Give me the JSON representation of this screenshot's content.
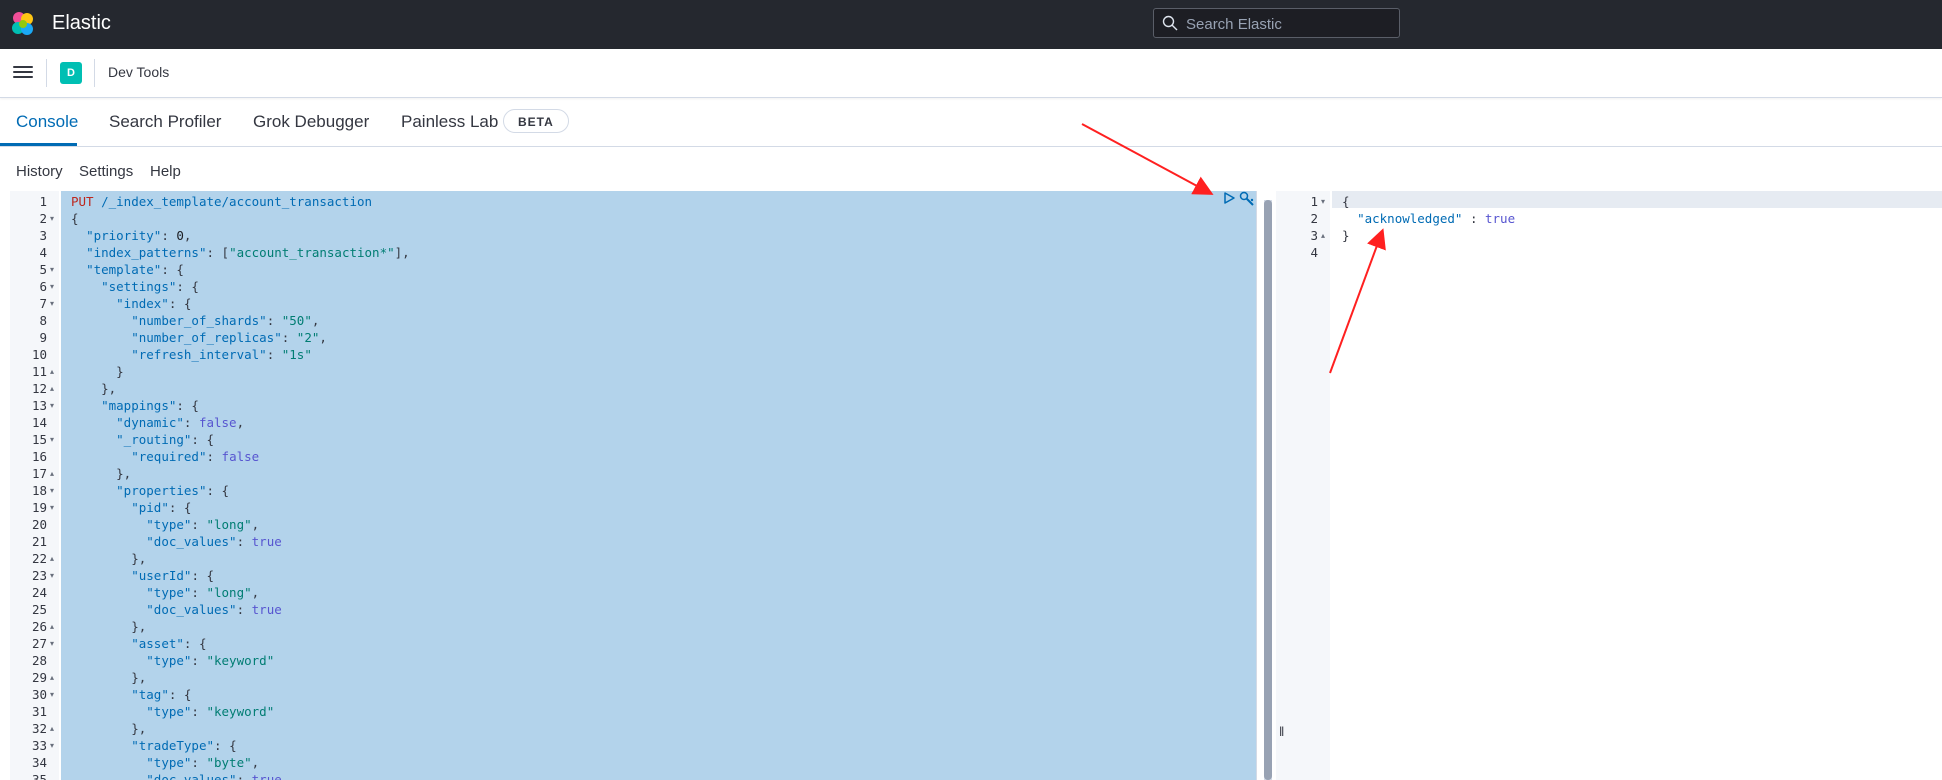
{
  "header": {
    "brand": "Elastic",
    "search_placeholder": "Search Elastic"
  },
  "breadcrumb": {
    "space_initial": "D",
    "current": "Dev Tools"
  },
  "tabs": [
    {
      "label": "Console",
      "active": true
    },
    {
      "label": "Search Profiler",
      "active": false
    },
    {
      "label": "Grok Debugger",
      "active": false
    },
    {
      "label": "Painless Lab",
      "active": false
    }
  ],
  "beta_label": "BETA",
  "console_menu": [
    "History",
    "Settings",
    "Help"
  ],
  "editor": {
    "lines": [
      {
        "n": "1",
        "fold": "",
        "text": "PUT /_index_template/account_transaction"
      },
      {
        "n": "2",
        "fold": "down",
        "text": "{"
      },
      {
        "n": "3",
        "fold": "",
        "text": "  \"priority\": 0,"
      },
      {
        "n": "4",
        "fold": "",
        "text": "  \"index_patterns\": [\"account_transaction*\"],"
      },
      {
        "n": "5",
        "fold": "down",
        "text": "  \"template\": {"
      },
      {
        "n": "6",
        "fold": "down",
        "text": "    \"settings\": {"
      },
      {
        "n": "7",
        "fold": "down",
        "text": "      \"index\": {"
      },
      {
        "n": "8",
        "fold": "",
        "text": "        \"number_of_shards\": \"50\","
      },
      {
        "n": "9",
        "fold": "",
        "text": "        \"number_of_replicas\": \"2\","
      },
      {
        "n": "10",
        "fold": "",
        "text": "        \"refresh_interval\": \"1s\""
      },
      {
        "n": "11",
        "fold": "up",
        "text": "      }"
      },
      {
        "n": "12",
        "fold": "up",
        "text": "    },"
      },
      {
        "n": "13",
        "fold": "down",
        "text": "    \"mappings\": {"
      },
      {
        "n": "14",
        "fold": "",
        "text": "      \"dynamic\": false,"
      },
      {
        "n": "15",
        "fold": "down",
        "text": "      \"_routing\": {"
      },
      {
        "n": "16",
        "fold": "",
        "text": "        \"required\": false"
      },
      {
        "n": "17",
        "fold": "up",
        "text": "      },"
      },
      {
        "n": "18",
        "fold": "down",
        "text": "      \"properties\": {"
      },
      {
        "n": "19",
        "fold": "down",
        "text": "        \"pid\": {"
      },
      {
        "n": "20",
        "fold": "",
        "text": "          \"type\": \"long\","
      },
      {
        "n": "21",
        "fold": "",
        "text": "          \"doc_values\": true"
      },
      {
        "n": "22",
        "fold": "up",
        "text": "        },"
      },
      {
        "n": "23",
        "fold": "down",
        "text": "        \"userId\": {"
      },
      {
        "n": "24",
        "fold": "",
        "text": "          \"type\": \"long\","
      },
      {
        "n": "25",
        "fold": "",
        "text": "          \"doc_values\": true"
      },
      {
        "n": "26",
        "fold": "up",
        "text": "        },"
      },
      {
        "n": "27",
        "fold": "down",
        "text": "        \"asset\": {"
      },
      {
        "n": "28",
        "fold": "",
        "text": "          \"type\": \"keyword\""
      },
      {
        "n": "29",
        "fold": "up",
        "text": "        },"
      },
      {
        "n": "30",
        "fold": "down",
        "text": "        \"tag\": {"
      },
      {
        "n": "31",
        "fold": "",
        "text": "          \"type\": \"keyword\""
      },
      {
        "n": "32",
        "fold": "up",
        "text": "        },"
      },
      {
        "n": "33",
        "fold": "down",
        "text": "        \"tradeType\": {"
      },
      {
        "n": "34",
        "fold": "",
        "text": "          \"type\": \"byte\","
      },
      {
        "n": "35",
        "fold": "",
        "text": "          \"doc_values\": true"
      }
    ]
  },
  "output": {
    "lines": [
      {
        "n": "1",
        "fold": "down",
        "text": "{"
      },
      {
        "n": "2",
        "fold": "",
        "text": "  \"acknowledged\" : true"
      },
      {
        "n": "3",
        "fold": "up",
        "text": "}"
      },
      {
        "n": "4",
        "fold": "",
        "text": ""
      }
    ]
  },
  "colors": {
    "header_bg": "#25282f",
    "accent": "#006bb4",
    "selection": "#b3d3eb",
    "annotation_arrow": "#ff2020"
  }
}
